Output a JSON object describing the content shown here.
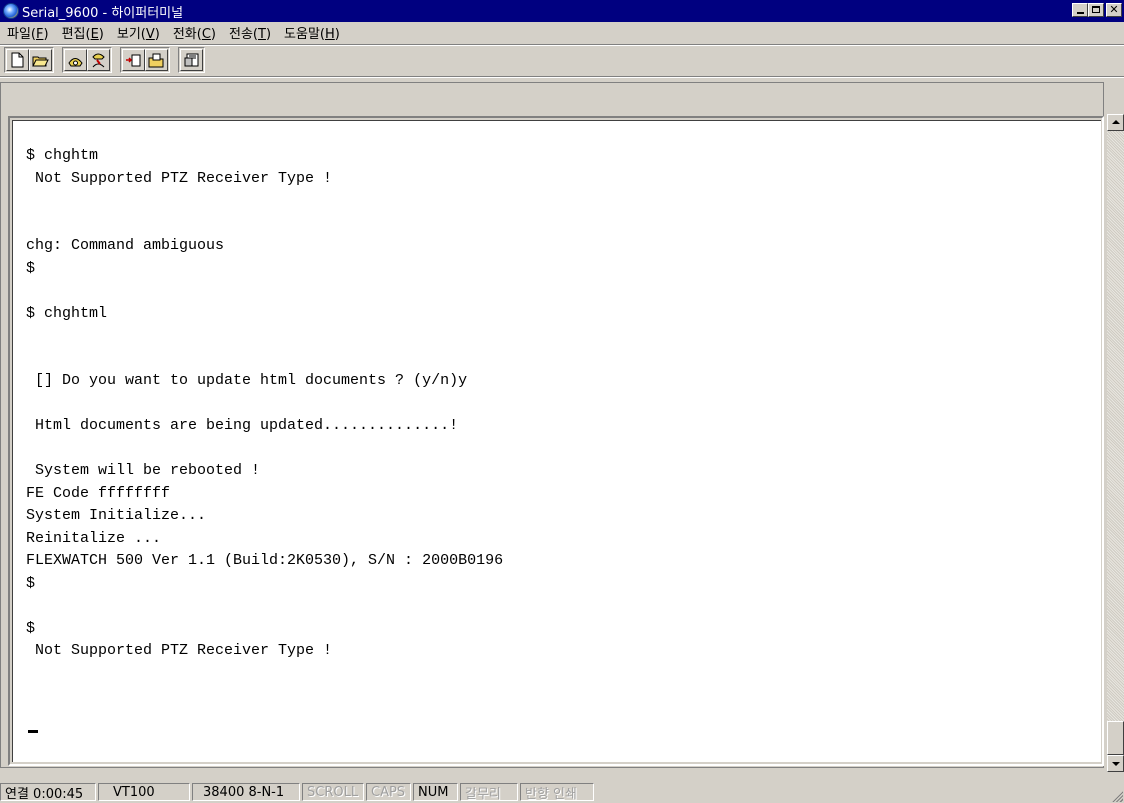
{
  "window": {
    "title": "Serial_9600 - 하이퍼터미널",
    "colors": {
      "titlebar": "#000080",
      "chrome": "#d4d0c8",
      "terminal_bg": "#ffffff"
    }
  },
  "menu": [
    {
      "label": "파일(",
      "key": "F",
      "suffix": ")"
    },
    {
      "label": "편집(",
      "key": "E",
      "suffix": ")"
    },
    {
      "label": "보기(",
      "key": "V",
      "suffix": ")"
    },
    {
      "label": "전화(",
      "key": "C",
      "suffix": ")"
    },
    {
      "label": "전송(",
      "key": "T",
      "suffix": ")"
    },
    {
      "label": "도움말(",
      "key": "H",
      "suffix": ")"
    }
  ],
  "toolbar": {
    "icons": [
      "new-document-icon",
      "open-folder-icon",
      "phone-connect-icon",
      "disconnect-icon",
      "send-icon",
      "receive-icon",
      "properties-icon"
    ]
  },
  "terminal": {
    "lines": [
      "$ chghtm",
      " Not Supported PTZ Receiver Type !",
      "",
      "",
      "chg: Command ambiguous",
      "$",
      "",
      "$ chghtml",
      "",
      "",
      " [] Do you want to update html documents ? (y/n)y",
      "",
      " Html documents are being updated..............!",
      "",
      " System will be rebooted !",
      "FE Code ffffffff",
      "System Initialize...",
      "Reinitalize ...",
      "FLEXWATCH 500 Ver 1.1 (Build:2K0530), S/N : 2000B0196",
      "$",
      "",
      "$",
      " Not Supported PTZ Receiver Type !"
    ]
  },
  "status": {
    "connection": "연결 0:00:45",
    "emulation": "VT100",
    "port": "38400 8-N-1",
    "scroll": "SCROLL",
    "caps": "CAPS",
    "num": "NUM",
    "capture": "갈무리",
    "print_echo": "반향 인쇄"
  }
}
